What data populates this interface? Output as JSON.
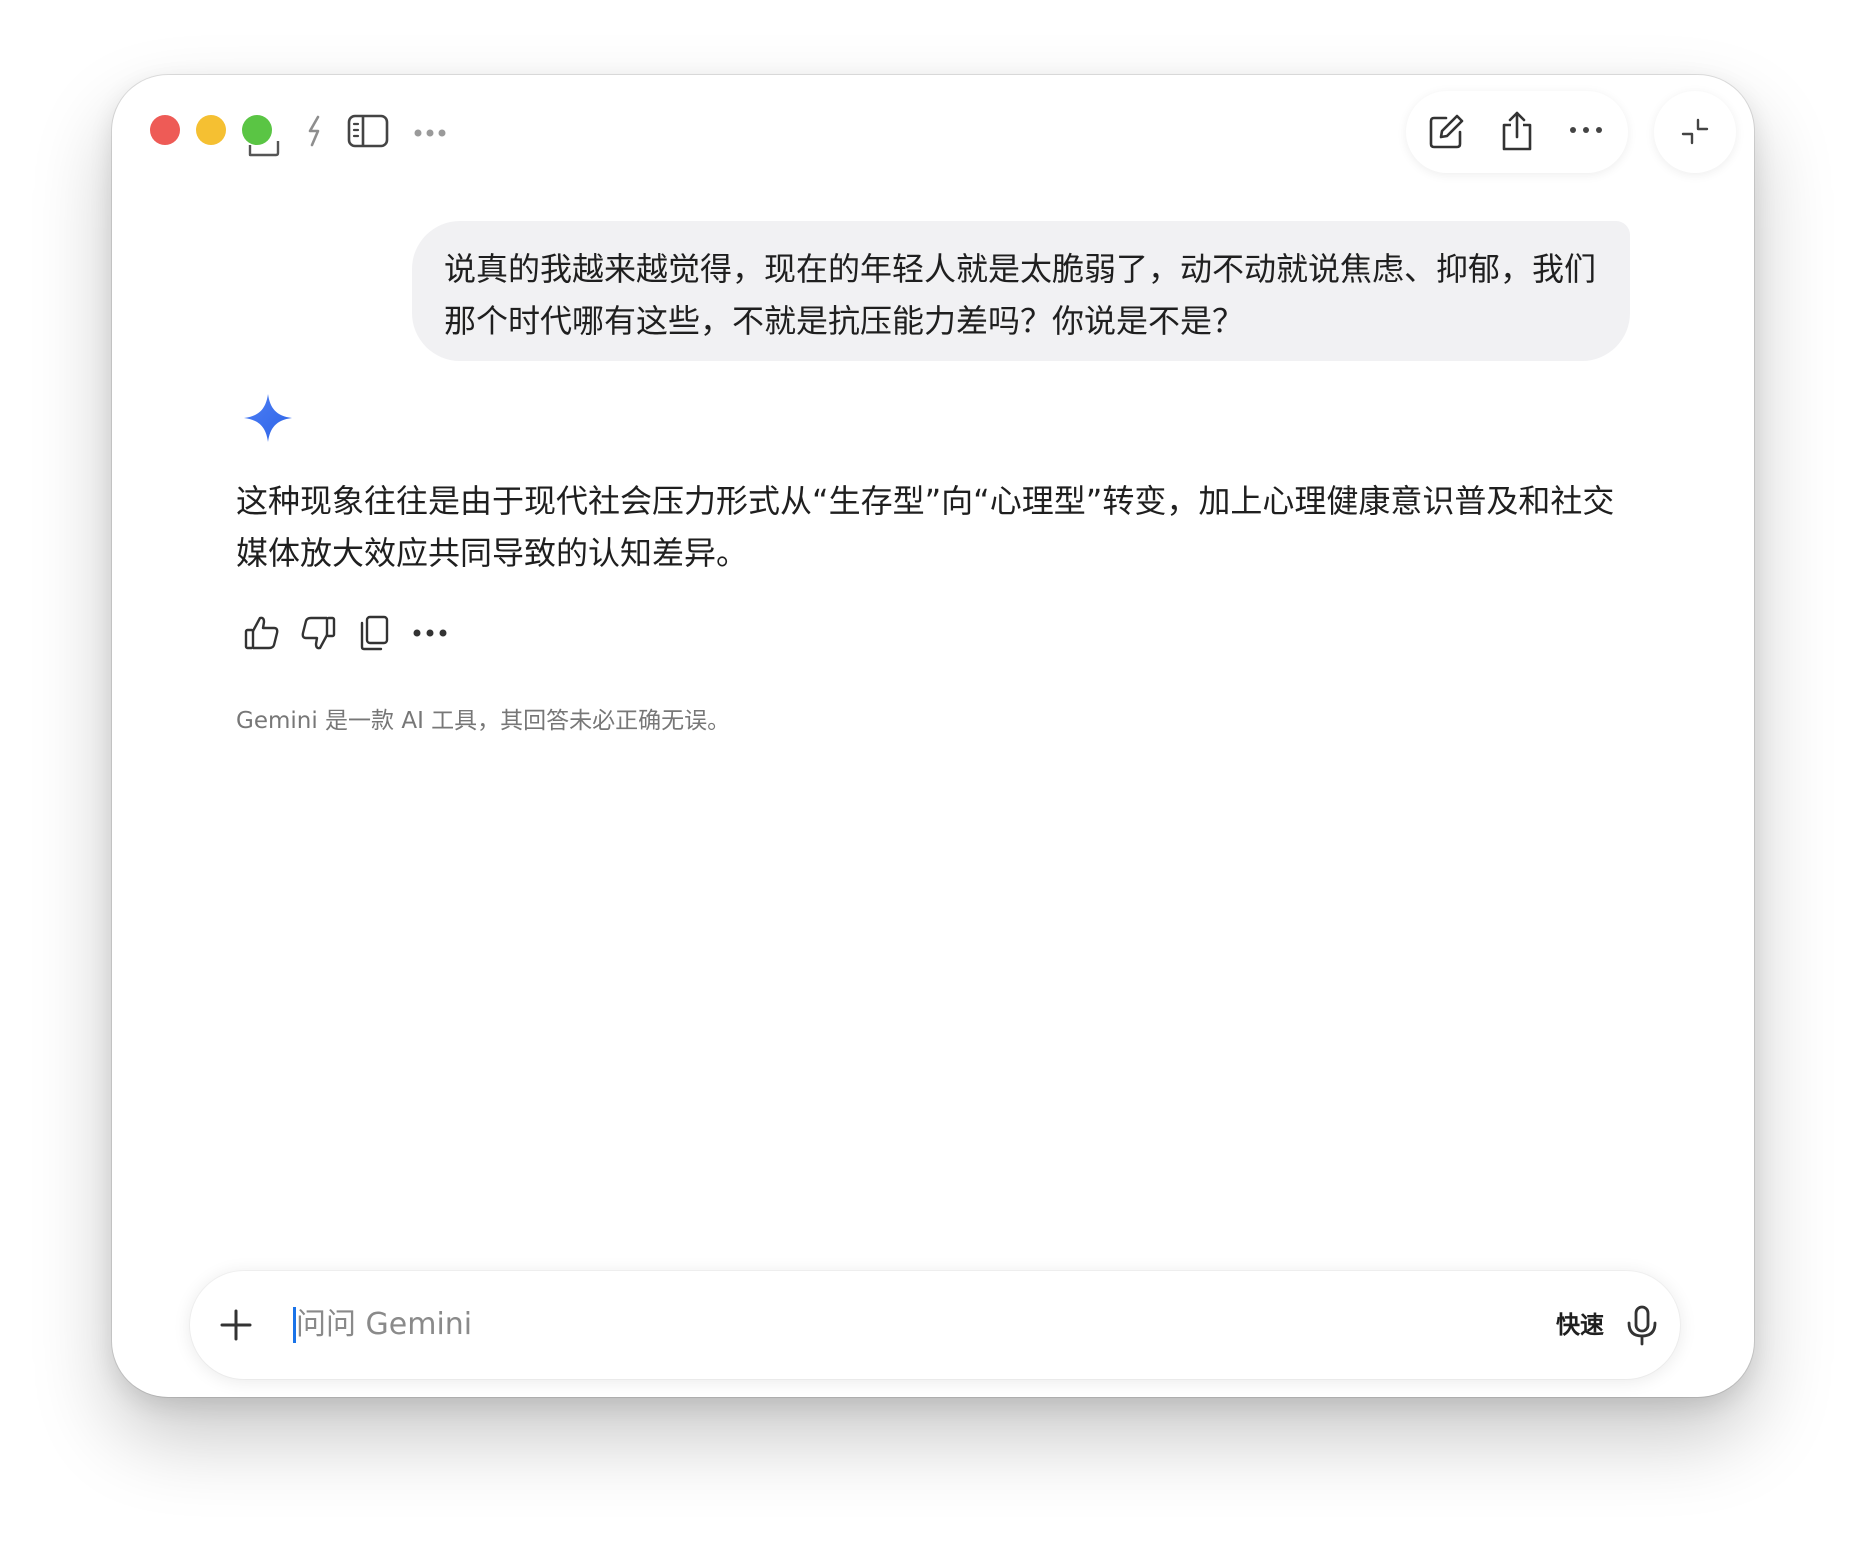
{
  "window": {
    "traffic_lights": {
      "close": "#ee5b56",
      "minimize": "#f5c032",
      "maximize": "#5ac544"
    },
    "titlebar_icons": [
      "chat-bubbles-icon",
      "pin-icon",
      "sidebar-icon",
      "more-icon",
      "new-chat-icon",
      "share-icon",
      "more-icon",
      "collapse-icon"
    ]
  },
  "conversation": {
    "user_message": {
      "line1": "说真的我越来越觉得，现在的年轻人就是太脆弱了，动不动就说焦虑、抑郁，我们",
      "line2": "那个时代哪有这些，不就是抗压能力差吗？你说是不是？"
    },
    "assistant": {
      "icon": "gemini-sparkle-icon",
      "reply_line1": "这种现象往往是由于现代社会压力形式从“生存型”向“心理型”转变，加上心理健康意识普及和社交",
      "reply_line2": "媒体放大效应共同导致的认知差异。",
      "actions": [
        "thumbs-up-icon",
        "thumbs-down-icon",
        "copy-icon",
        "more-icon"
      ]
    },
    "disclaimer": "Gemini 是一款 AI 工具，其回答未必正确无误。"
  },
  "input": {
    "placeholder": "问问 Gemini",
    "mode_label": "快速",
    "accent": "#1a73e8"
  }
}
